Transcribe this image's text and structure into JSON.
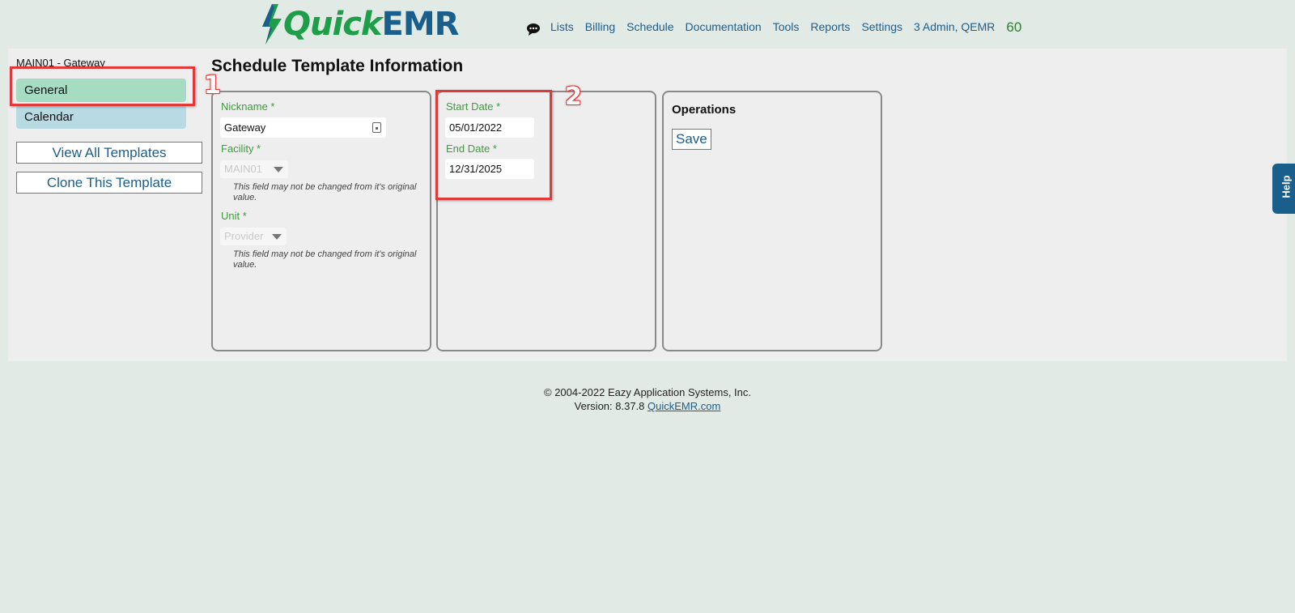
{
  "header": {
    "logo_quick": "Quick",
    "logo_emr": "EMR",
    "nav": [
      "Lists",
      "Billing",
      "Schedule",
      "Documentation",
      "Tools",
      "Reports",
      "Settings",
      "3 Admin, QEMR"
    ],
    "count": "60"
  },
  "sidebar": {
    "breadcrumb": "MAIN01 - Gateway",
    "items": [
      {
        "label": "General"
      },
      {
        "label": "Calendar"
      }
    ],
    "view_all": "View All Templates",
    "clone": "Clone This Template"
  },
  "page": {
    "title": "Schedule Template Information"
  },
  "general": {
    "nickname_label": "Nickname *",
    "nickname_value": "Gateway",
    "facility_label": "Facility *",
    "facility_value": "MAIN01",
    "facility_note": "This field may not be changed from it's original value.",
    "unit_label": "Unit *",
    "unit_value": "Provider",
    "unit_note": "This field may not be changed from it's original value."
  },
  "dates": {
    "start_label": "Start Date *",
    "start_value": "05/01/2022",
    "end_label": "End Date *",
    "end_value": "12/31/2025"
  },
  "operations": {
    "title": "Operations",
    "save": "Save"
  },
  "annotations": [
    "1",
    "2"
  ],
  "help": "Help",
  "footer": {
    "copyright": "© 2004-2022 Eazy Application Systems, Inc.",
    "version": "Version: 8.37.8",
    "link": "QuickEMR.com"
  },
  "colors": {
    "brand_green": "#1e9e49",
    "brand_blue": "#1a5e8c",
    "annotation_red": "#e0393a"
  }
}
